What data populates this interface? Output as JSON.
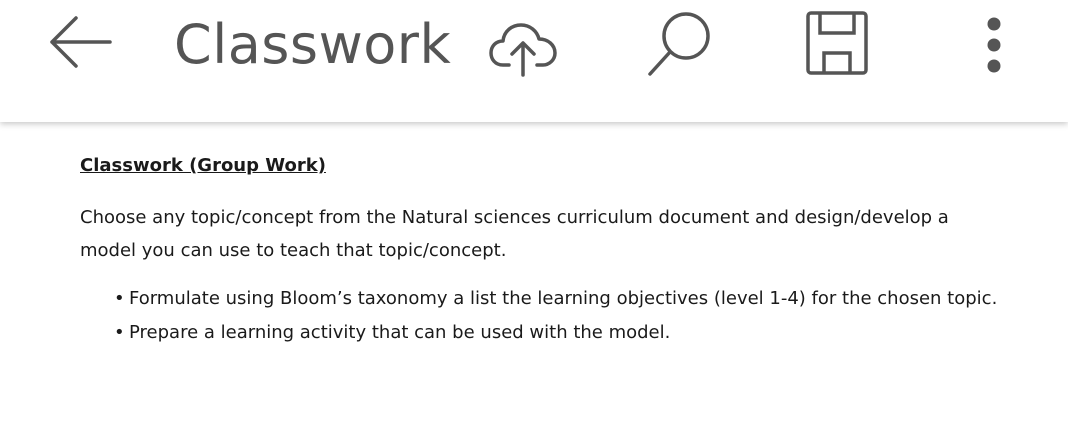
{
  "toolbar": {
    "title": "Classwork",
    "icons": [
      "back-arrow-icon",
      "cloud-upload-icon",
      "search-icon",
      "save-icon",
      "more-vertical-icon"
    ],
    "icon_color": "#555555"
  },
  "document": {
    "heading": "Classwork (Group Work)",
    "paragraph": "Choose any topic/concept from the Natural sciences curriculum document and design/develop a model you can use to teach that topic/concept.",
    "bullet_symbol": "•",
    "bullets": [
      "Formulate using Bloom’s taxonomy a list the learning objectives (level 1-4) for the chosen topic.",
      "Prepare a learning activity that can be used with the model."
    ]
  }
}
